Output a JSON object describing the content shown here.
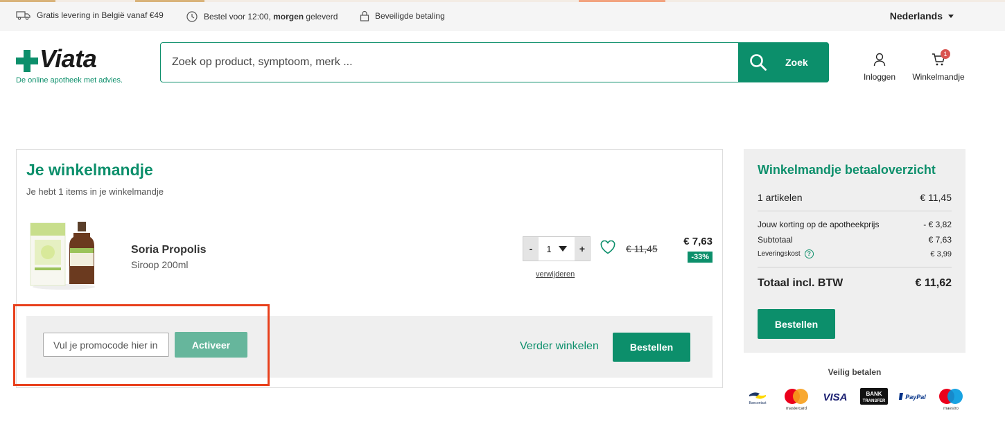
{
  "topbar": {
    "usp1": "Gratis levering in België vanaf €49",
    "usp2_pre": "Bestel voor 12:00, ",
    "usp2_bold": "morgen",
    "usp2_post": " geleverd",
    "usp3": "Beveiligde betaling",
    "language": "Nederlands"
  },
  "header": {
    "logo_text": "Viata",
    "tagline": "De online apotheek met advies.",
    "search_placeholder": "Zoek op product, symptoom, merk ...",
    "search_button": "Zoek",
    "login_label": "Inloggen",
    "cart_label": "Winkelmandje",
    "cart_count": "1"
  },
  "cart": {
    "title": "Je winkelmandje",
    "subtitle": "Je hebt 1 items in je winkelmandje",
    "item": {
      "name": "Soria Propolis",
      "variant": "Siroop 200ml",
      "qty_minus": "-",
      "qty_value": "1",
      "qty_plus": "+",
      "remove": "verwijderen",
      "old_price": "€ 11,45",
      "price": "€ 7,63",
      "discount": "-33%"
    },
    "promo_placeholder": "Vul je promocode hier in",
    "promo_button": "Activeer",
    "continue": "Verder winkelen",
    "order": "Bestellen"
  },
  "summary": {
    "title": "Winkelmandje betaaloverzicht",
    "articles_label": "1 artikelen",
    "articles_value": "€ 11,45",
    "discount_label": "Jouw korting op de apotheekprijs",
    "discount_value": "- € 3,82",
    "subtotal_label": "Subtotaal",
    "subtotal_value": "€ 7,63",
    "delivery_label": "Leveringskost",
    "delivery_value": "€ 3,99",
    "total_label": "Totaal incl. BTW",
    "total_value": "€ 11,62",
    "order_button": "Bestellen"
  },
  "payment": {
    "title": "Veilig betalen",
    "bancontact": "Bancontact",
    "mastercard": "mastercard",
    "visa": "VISA",
    "bank_transfer_1": "BANK",
    "bank_transfer_2": "TRANSFER",
    "paypal": "PayPal",
    "maestro": "maestro"
  },
  "colors": {
    "brand_green": "#0c8f6b",
    "highlight_red": "#e8401c"
  }
}
